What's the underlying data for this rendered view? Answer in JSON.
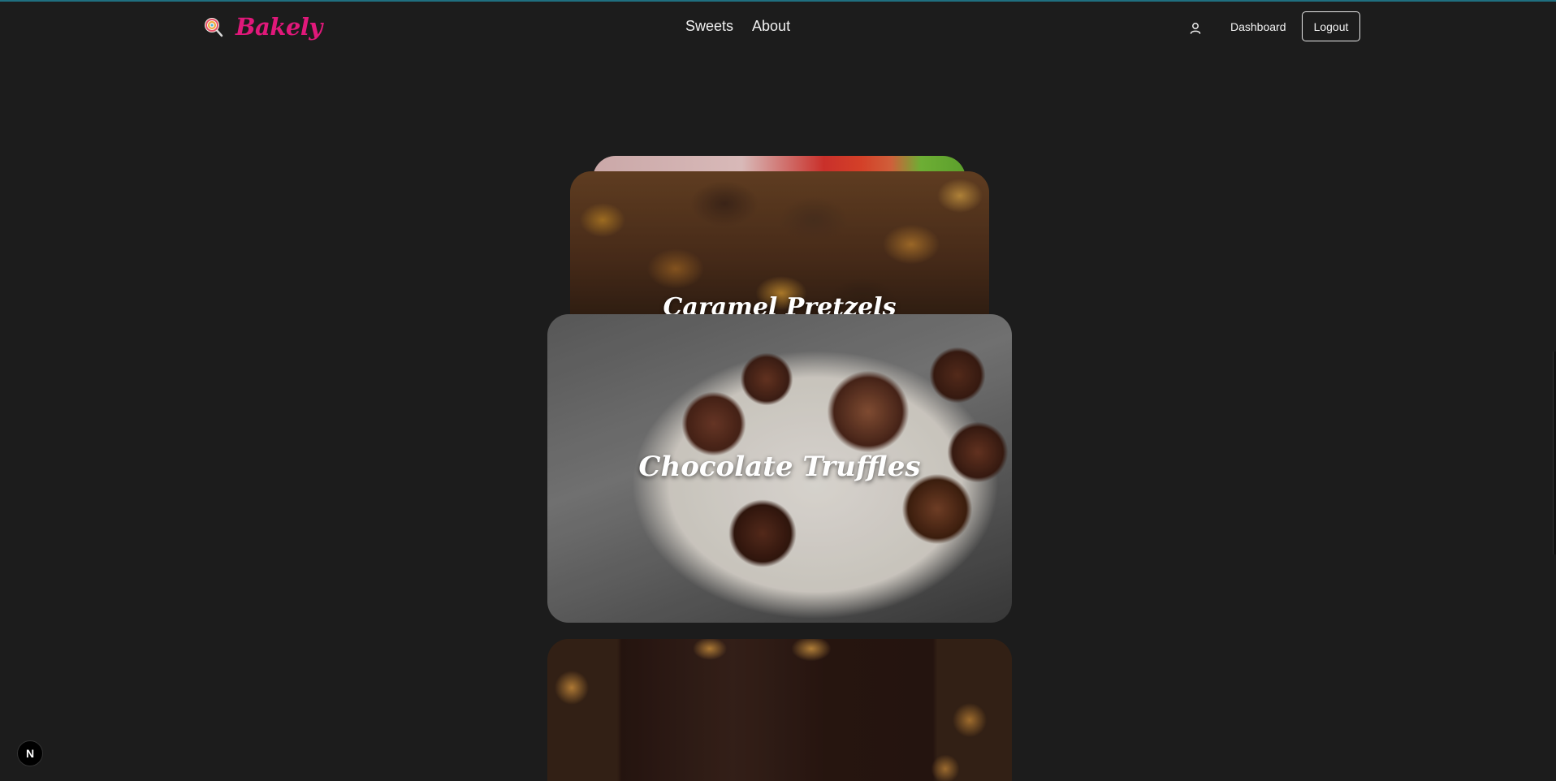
{
  "header": {
    "brand": "Bakely",
    "nav": [
      {
        "label": "Sweets"
      },
      {
        "label": "About"
      }
    ],
    "dashboard_label": "Dashboard",
    "logout_label": "Logout"
  },
  "cards": [
    {
      "title": ""
    },
    {
      "title": "Caramel Pretzels"
    },
    {
      "title": "Chocolate Truffles"
    },
    {
      "title": ""
    }
  ],
  "dev_badge": "N",
  "colors": {
    "background": "#1c1c1c",
    "brand": "#e0187a",
    "text": "#ffffff"
  }
}
